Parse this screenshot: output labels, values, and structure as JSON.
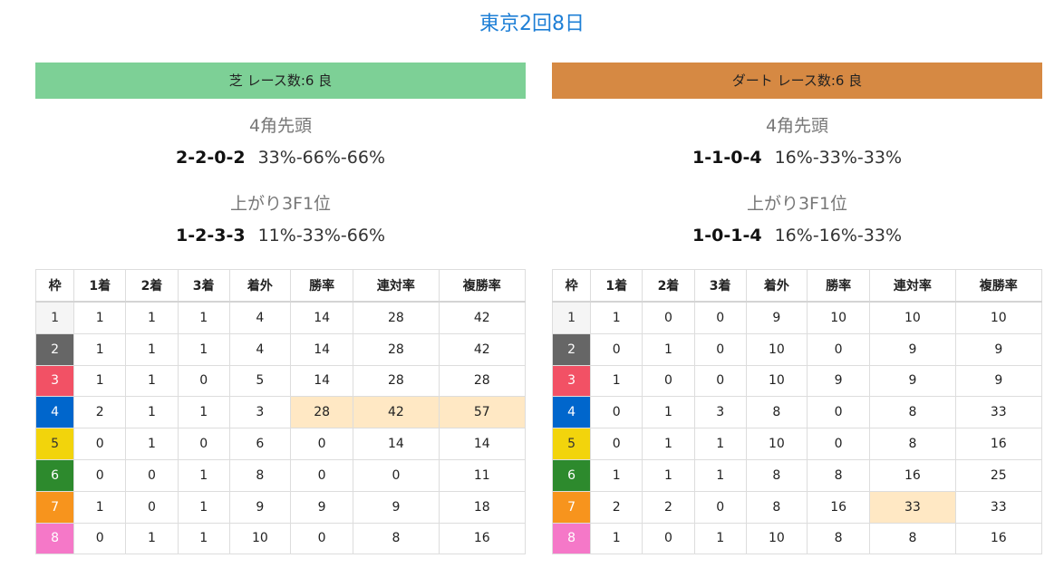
{
  "title": "東京2回8日",
  "colors": {
    "turf_header": "#7dd096",
    "dirt_header": "#d68943",
    "highlight": "#ffe8c4",
    "waku": [
      "#f5f5f5",
      "#666666",
      "#f25165",
      "#0066cc",
      "#f2d40c",
      "#2d8a2d",
      "#f7941d",
      "#f578c8"
    ],
    "waku_text": [
      "#333333",
      "#ffffff",
      "#ffffff",
      "#ffffff",
      "#333333",
      "#ffffff",
      "#ffffff",
      "#ffffff"
    ]
  },
  "panels": [
    {
      "key": "turf",
      "header": "芝 レース数:6  良",
      "corner4": {
        "label": "4角先頭",
        "record": [
          "2",
          "2",
          "0",
          "2"
        ],
        "rates": "33%-66%-66%"
      },
      "last3f": {
        "label": "上がり3F1位",
        "record": [
          "1",
          "2",
          "3",
          "3"
        ],
        "rates": "11%-33%-66%"
      },
      "columns": [
        "枠",
        "1着",
        "2着",
        "3着",
        "着外",
        "勝率",
        "連対率",
        "複勝率"
      ],
      "rows": [
        [
          "1",
          "1",
          "1",
          "1",
          "4",
          "14",
          "28",
          "42"
        ],
        [
          "2",
          "1",
          "1",
          "1",
          "4",
          "14",
          "28",
          "42"
        ],
        [
          "3",
          "1",
          "1",
          "0",
          "5",
          "14",
          "28",
          "28"
        ],
        [
          "4",
          "2",
          "1",
          "1",
          "3",
          "28",
          "42",
          "57"
        ],
        [
          "5",
          "0",
          "1",
          "0",
          "6",
          "0",
          "14",
          "14"
        ],
        [
          "6",
          "0",
          "0",
          "1",
          "8",
          "0",
          "0",
          "11"
        ],
        [
          "7",
          "1",
          "0",
          "1",
          "9",
          "9",
          "9",
          "18"
        ],
        [
          "8",
          "0",
          "1",
          "1",
          "10",
          "0",
          "8",
          "16"
        ]
      ],
      "highlights": [
        [
          3,
          5
        ],
        [
          3,
          6
        ],
        [
          3,
          7
        ]
      ]
    },
    {
      "key": "dirt",
      "header": "ダート レース数:6  良",
      "corner4": {
        "label": "4角先頭",
        "record": [
          "1",
          "1",
          "0",
          "4"
        ],
        "rates": "16%-33%-33%"
      },
      "last3f": {
        "label": "上がり3F1位",
        "record": [
          "1",
          "0",
          "1",
          "4"
        ],
        "rates": "16%-16%-33%"
      },
      "columns": [
        "枠",
        "1着",
        "2着",
        "3着",
        "着外",
        "勝率",
        "連対率",
        "複勝率"
      ],
      "rows": [
        [
          "1",
          "1",
          "0",
          "0",
          "9",
          "10",
          "10",
          "10"
        ],
        [
          "2",
          "0",
          "1",
          "0",
          "10",
          "0",
          "9",
          "9"
        ],
        [
          "3",
          "1",
          "0",
          "0",
          "10",
          "9",
          "9",
          "9"
        ],
        [
          "4",
          "0",
          "1",
          "3",
          "8",
          "0",
          "8",
          "33"
        ],
        [
          "5",
          "0",
          "1",
          "1",
          "10",
          "0",
          "8",
          "16"
        ],
        [
          "6",
          "1",
          "1",
          "1",
          "8",
          "8",
          "16",
          "25"
        ],
        [
          "7",
          "2",
          "2",
          "0",
          "8",
          "16",
          "33",
          "33"
        ],
        [
          "8",
          "1",
          "0",
          "1",
          "10",
          "8",
          "8",
          "16"
        ]
      ],
      "highlights": [
        [
          6,
          6
        ]
      ]
    }
  ]
}
